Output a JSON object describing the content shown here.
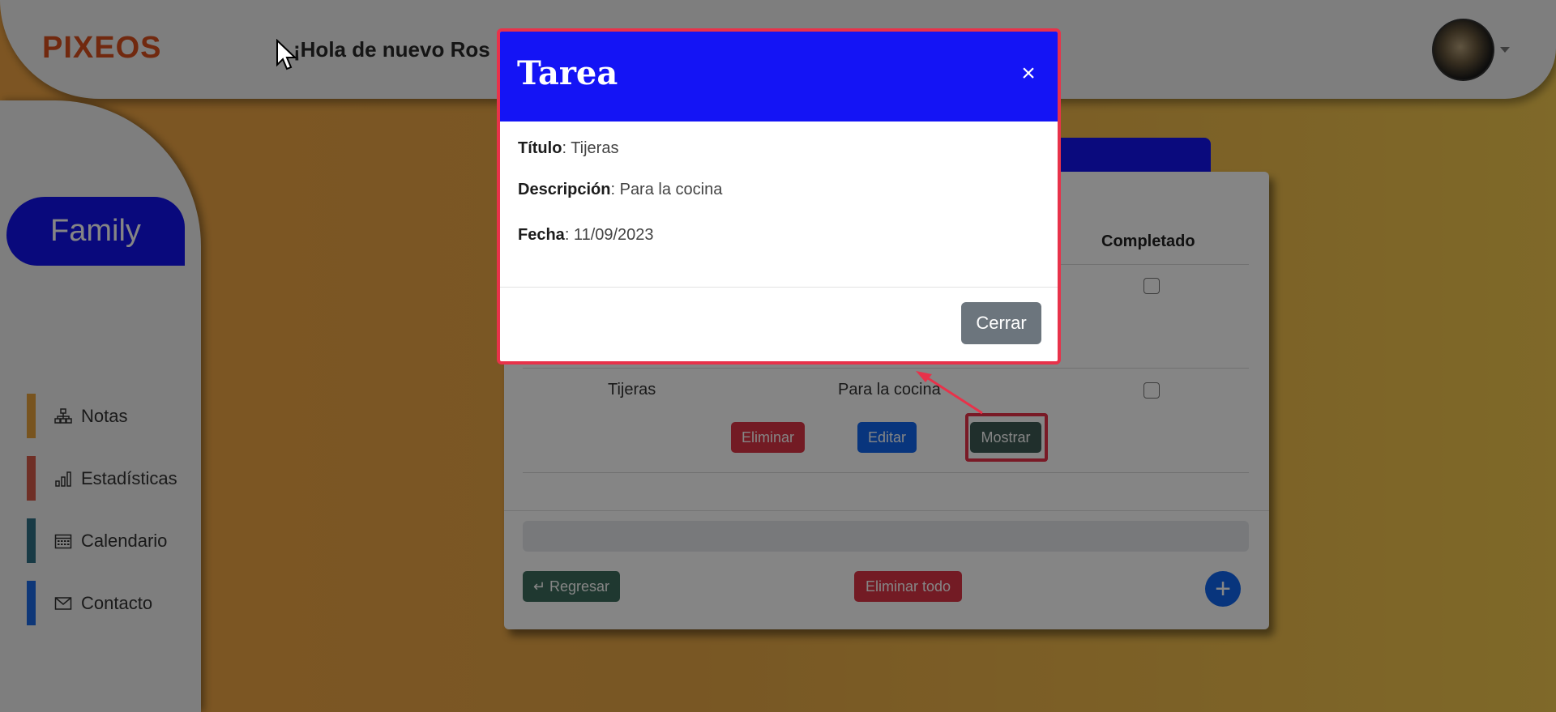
{
  "header": {
    "logo": "PIXEOS",
    "greeting": "¡Hola de nuevo Ros"
  },
  "sidebar": {
    "family_label": "Family",
    "items": [
      {
        "label": "Notas",
        "icon": "sitemap-icon",
        "bar_color": "#e6a23c"
      },
      {
        "label": "Estadísticas",
        "icon": "bar-chart-icon",
        "bar_color": "#d55a4a"
      },
      {
        "label": "Calendario",
        "icon": "calendar-icon",
        "bar_color": "#2e6f85"
      },
      {
        "label": "Contacto",
        "icon": "envelope-icon",
        "bar_color": "#1c6ae6"
      }
    ]
  },
  "table": {
    "header_completado": "Completado",
    "row": {
      "title": "Tijeras",
      "description": "Para la cocina",
      "delete_label": "Eliminar",
      "edit_label": "Editar",
      "show_label": "Mostrar"
    }
  },
  "footer": {
    "back_label": "↵ Regresar",
    "delete_all_label": "Eliminar todo",
    "add_label": "+"
  },
  "modal": {
    "title": "Tarea",
    "close_symbol": "×",
    "fields": [
      {
        "label": "Título",
        "value": ": Tijeras"
      },
      {
        "label": "Descripción",
        "value": ": Para la cocina"
      },
      {
        "label": "Fecha",
        "value": ": 11/09/2023"
      }
    ],
    "close_button": "Cerrar"
  },
  "colors": {
    "accent_blue": "#1414f5",
    "highlight_red": "#e8324a"
  }
}
